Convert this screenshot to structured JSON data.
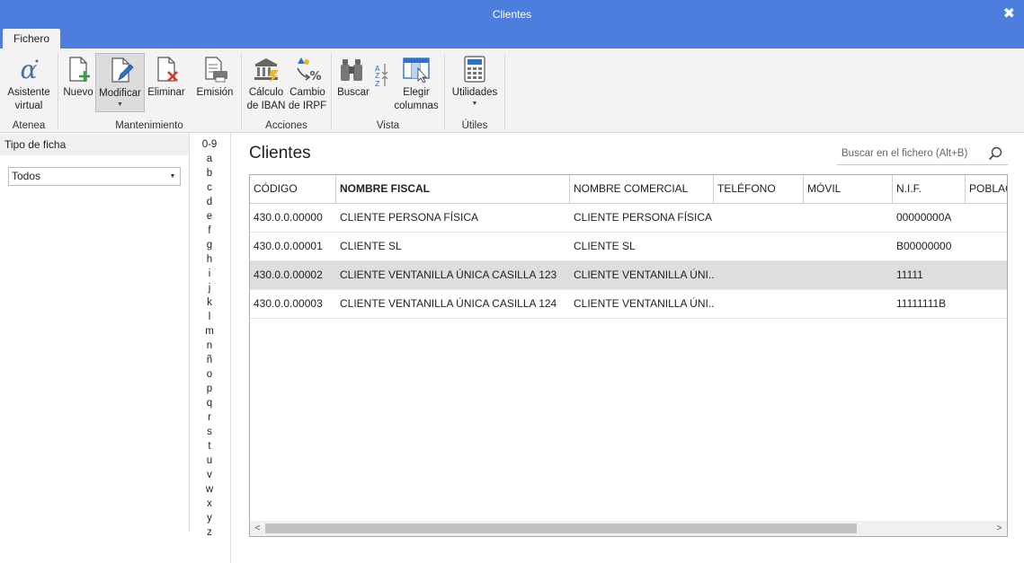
{
  "window": {
    "title": "Clientes",
    "close": "✖"
  },
  "tabs": {
    "active": "Fichero"
  },
  "ribbon": {
    "groups": {
      "atenea": "Atenea",
      "mantenimiento": "Mantenimiento",
      "acciones": "Acciones",
      "vista": "Vista",
      "utiles": "Útiles"
    },
    "buttons": {
      "asistente_1": "Asistente",
      "asistente_2": "virtual",
      "nuevo": "Nuevo",
      "modificar": "Modificar",
      "eliminar": "Eliminar",
      "emision": "Emisión",
      "calculo_1": "Cálculo",
      "calculo_2": "de IBAN",
      "cambio_1": "Cambio",
      "cambio_2": "de IRPF",
      "buscar": "Buscar",
      "elegir_1": "Elegir",
      "elegir_2": "columnas",
      "utilidades": "Utilidades"
    },
    "icons": [
      "alpha-icon",
      "new-document-icon",
      "edit-document-icon",
      "delete-document-icon",
      "print-document-icon",
      "bank-icon",
      "irpf-percent-icon",
      "binoculars-icon",
      "sort-icon",
      "columns-icon",
      "calculator-icon"
    ],
    "colors": {
      "accent": "#4d7ede",
      "green": "#2e9e3e",
      "red": "#d9362b",
      "blue": "#2f6fcf"
    }
  },
  "sidebar": {
    "title": "Tipo de ficha",
    "filter": {
      "selected": "Todos"
    },
    "alphabet": [
      "0-9",
      "a",
      "b",
      "c",
      "d",
      "e",
      "f",
      "g",
      "h",
      "i",
      "j",
      "k",
      "l",
      "m",
      "n",
      "ñ",
      "o",
      "p",
      "q",
      "r",
      "s",
      "t",
      "u",
      "v",
      "w",
      "x",
      "y",
      "z"
    ]
  },
  "main": {
    "title": "Clientes",
    "search": {
      "placeholder": "Buscar en el fichero (Alt+B)"
    },
    "columns": [
      "CÓDIGO",
      "NOMBRE FISCAL",
      "NOMBRE COMERCIAL",
      "TELÉFONO",
      "MÓVIL",
      "N.I.F.",
      "POBLAC"
    ],
    "rows": [
      {
        "codigo": "430.0.0.00000",
        "nombre_fiscal": "CLIENTE PERSONA FÍSICA",
        "nombre_comercial": "CLIENTE PERSONA FÍSICA",
        "telefono": "",
        "movil": "",
        "nif": "00000000A",
        "poblacion": ""
      },
      {
        "codigo": "430.0.0.00001",
        "nombre_fiscal": "CLIENTE SL",
        "nombre_comercial": "CLIENTE SL",
        "telefono": "",
        "movil": "",
        "nif": "B00000000",
        "poblacion": ""
      },
      {
        "codigo": "430.0.0.00002",
        "nombre_fiscal": "CLIENTE VENTANILLA ÚNICA CASILLA 123",
        "nombre_comercial": "CLIENTE VENTANILLA ÚNI...",
        "telefono": "",
        "movil": "",
        "nif": "11111",
        "poblacion": ""
      },
      {
        "codigo": "430.0.0.00003",
        "nombre_fiscal": "CLIENTE VENTANILLA ÚNICA CASILLA 124",
        "nombre_comercial": "CLIENTE VENTANILLA ÚNI...",
        "telefono": "",
        "movil": "",
        "nif": "11111111B",
        "poblacion": ""
      }
    ],
    "selected_row": 2,
    "scroll": {
      "left": "<",
      "right": ">"
    }
  }
}
